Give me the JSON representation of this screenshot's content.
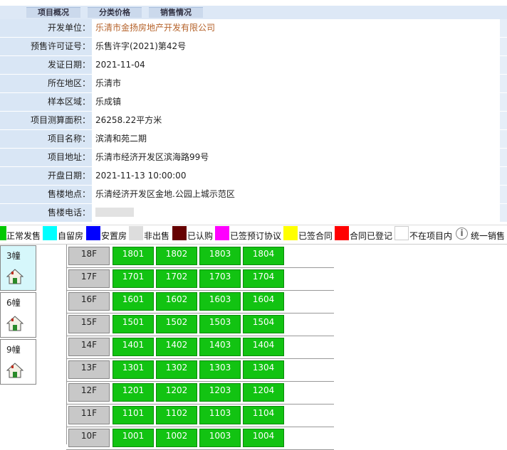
{
  "tabs": [
    "项目概况",
    "分类价格",
    "销售情况"
  ],
  "info_rows": [
    {
      "label": "开发单位：",
      "value": "乐清市金扬房地产开发有限公司",
      "accent": true
    },
    {
      "label": "预售许可证号：",
      "value": "乐售许字(2021)第42号"
    },
    {
      "label": "发证日期：",
      "value": "2021-11-04"
    },
    {
      "label": "所在地区：",
      "value": "乐清市"
    },
    {
      "label": "样本区域：",
      "value": "乐成镇"
    },
    {
      "label": "项目测算面积：",
      "value": "26258.22平方米"
    },
    {
      "label": "项目名称：",
      "value": "滨清和苑二期"
    },
    {
      "label": "项目地址：",
      "value": "乐清市经济开发区滨海路99号"
    },
    {
      "label": "开盘日期：",
      "value": "2021-11-13 10:00:00"
    },
    {
      "label": "售楼地点：",
      "value": "乐清经济开发区金地.公园上城示范区"
    },
    {
      "label": "售楼电话：",
      "value": ""
    }
  ],
  "legend": [
    {
      "label": "正常发售",
      "color": "#00c800"
    },
    {
      "label": "自留房",
      "color": "#00ffff"
    },
    {
      "label": "安置房",
      "color": "#0000ff"
    },
    {
      "label": "非出售",
      "color": "#dddddd"
    },
    {
      "label": "已认购",
      "color": "#660000"
    },
    {
      "label": "已签预订协议",
      "color": "#ff00ff"
    },
    {
      "label": "已签合同",
      "color": "#ffff00"
    },
    {
      "label": "合同已登记",
      "color": "#ff0000"
    },
    {
      "label": "不在项目内",
      "color": "#ffffff"
    },
    {
      "label": "统一销售",
      "color": ""
    }
  ],
  "buildings": [
    {
      "name": "3幢",
      "active": true
    },
    {
      "name": "6幢",
      "active": false
    },
    {
      "name": "9幢",
      "active": false
    }
  ],
  "floors": [
    {
      "floor": "18F",
      "units": [
        "1801",
        "1802",
        "1803",
        "1804"
      ]
    },
    {
      "floor": "17F",
      "units": [
        "1701",
        "1702",
        "1703",
        "1704"
      ]
    },
    {
      "floor": "16F",
      "units": [
        "1601",
        "1602",
        "1603",
        "1604"
      ]
    },
    {
      "floor": "15F",
      "units": [
        "1501",
        "1502",
        "1503",
        "1504"
      ]
    },
    {
      "floor": "14F",
      "units": [
        "1401",
        "1402",
        "1403",
        "1404"
      ]
    },
    {
      "floor": "13F",
      "units": [
        "1301",
        "1302",
        "1303",
        "1304"
      ]
    },
    {
      "floor": "12F",
      "units": [
        "1201",
        "1202",
        "1203",
        "1204"
      ]
    },
    {
      "floor": "11F",
      "units": [
        "1101",
        "1102",
        "1103",
        "1104"
      ]
    },
    {
      "floor": "10F",
      "units": [
        "1001",
        "1002",
        "1003",
        "1004"
      ]
    }
  ]
}
